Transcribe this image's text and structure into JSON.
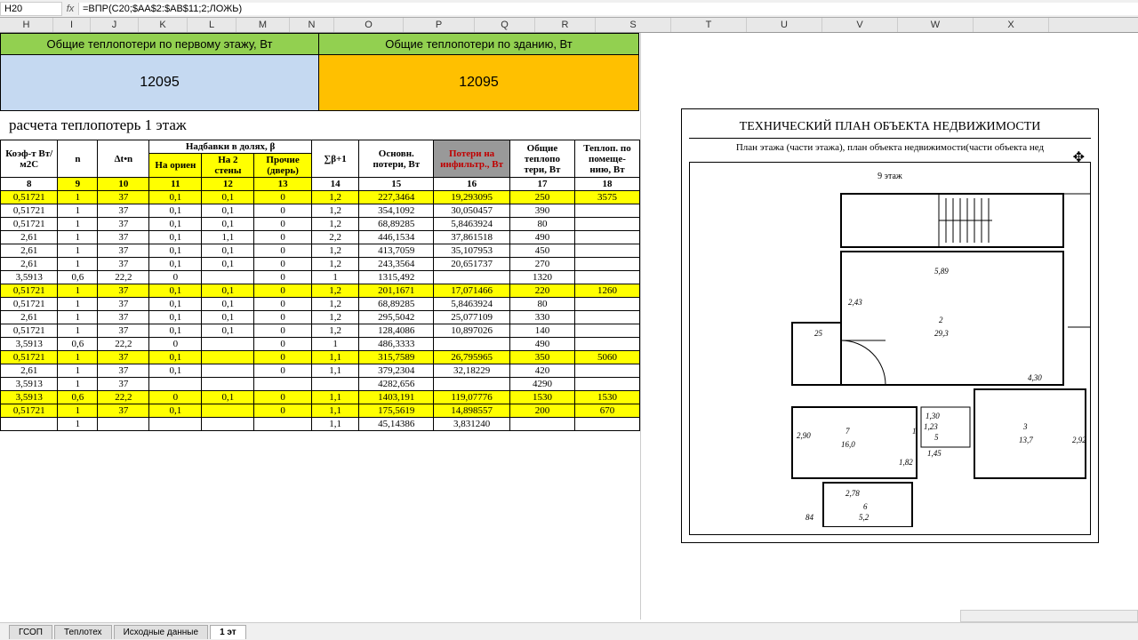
{
  "formula": {
    "cell": "H20",
    "value": "=ВПР(C20;$AA$2:$AB$11;2;ЛОЖЬ)"
  },
  "columns": [
    "H",
    "I",
    "J",
    "K",
    "L",
    "M",
    "N",
    "O",
    "P",
    "Q",
    "R",
    "S",
    "T",
    "U",
    "V",
    "W",
    "X"
  ],
  "summary": {
    "label1": "Общие теплопотери по первому этажу, Вт",
    "label2": "Общие теплопотери по зданию, Вт",
    "val1": "12095",
    "val2": "12095"
  },
  "title": "расчета теплопотерь 1 этаж",
  "headers": {
    "h8": "Коэф-т Вт/м2С",
    "h9": "n",
    "h10": "Δt•n",
    "hAdd": "Надбавки в долях, β",
    "h11": "На ориен",
    "h12": "На 2 стены",
    "h13": "Прочие (дверь)",
    "h14": "∑β+1",
    "h15": "Основн. потери, Вт",
    "h16": "Потери на инфильтр., Вт",
    "h17": "Общие теплопо тери, Вт",
    "h18": "Теплоп. по помеще- нию, Вт",
    "n8": "8",
    "n9": "9",
    "n10": "10",
    "n11": "11",
    "n12": "12",
    "n13": "13",
    "n14": "14",
    "n15": "15",
    "n16": "16",
    "n17": "17",
    "n18": "18"
  },
  "rows": [
    {
      "y": 1,
      "c": [
        "0,51721",
        "1",
        "37",
        "0,1",
        "0,1",
        "0",
        "1,2",
        "227,3464",
        "19,293095",
        "250",
        "3575"
      ]
    },
    {
      "y": 0,
      "c": [
        "0,51721",
        "1",
        "37",
        "0,1",
        "0,1",
        "0",
        "1,2",
        "354,1092",
        "30,050457",
        "390",
        ""
      ]
    },
    {
      "y": 0,
      "c": [
        "0,51721",
        "1",
        "37",
        "0,1",
        "0,1",
        "0",
        "1,2",
        "68,89285",
        "5,8463924",
        "80",
        ""
      ]
    },
    {
      "y": 0,
      "c": [
        "2,61",
        "1",
        "37",
        "0,1",
        "1,1",
        "0",
        "2,2",
        "446,1534",
        "37,861518",
        "490",
        ""
      ]
    },
    {
      "y": 0,
      "c": [
        "2,61",
        "1",
        "37",
        "0,1",
        "0,1",
        "0",
        "1,2",
        "413,7059",
        "35,107953",
        "450",
        ""
      ]
    },
    {
      "y": 0,
      "c": [
        "2,61",
        "1",
        "37",
        "0,1",
        "0,1",
        "0",
        "1,2",
        "243,3564",
        "20,651737",
        "270",
        ""
      ]
    },
    {
      "y": 0,
      "c": [
        "3,5913",
        "0,6",
        "22,2",
        "0",
        "",
        "0",
        "1",
        "1315,492",
        "",
        "1320",
        ""
      ]
    },
    {
      "y": 1,
      "c": [
        "0,51721",
        "1",
        "37",
        "0,1",
        "0,1",
        "0",
        "1,2",
        "201,1671",
        "17,071466",
        "220",
        "1260"
      ]
    },
    {
      "y": 0,
      "c": [
        "0,51721",
        "1",
        "37",
        "0,1",
        "0,1",
        "0",
        "1,2",
        "68,89285",
        "5,8463924",
        "80",
        ""
      ]
    },
    {
      "y": 0,
      "c": [
        "2,61",
        "1",
        "37",
        "0,1",
        "0,1",
        "0",
        "1,2",
        "295,5042",
        "25,077109",
        "330",
        ""
      ]
    },
    {
      "y": 0,
      "c": [
        "0,51721",
        "1",
        "37",
        "0,1",
        "0,1",
        "0",
        "1,2",
        "128,4086",
        "10,897026",
        "140",
        ""
      ]
    },
    {
      "y": 0,
      "c": [
        "3,5913",
        "0,6",
        "22,2",
        "0",
        "",
        "0",
        "1",
        "486,3333",
        "",
        "490",
        ""
      ]
    },
    {
      "y": 1,
      "c": [
        "0,51721",
        "1",
        "37",
        "0,1",
        "",
        "0",
        "1,1",
        "315,7589",
        "26,795965",
        "350",
        "5060"
      ]
    },
    {
      "y": 0,
      "c": [
        "2,61",
        "1",
        "37",
        "0,1",
        "",
        "0",
        "1,1",
        "379,2304",
        "32,18229",
        "420",
        ""
      ]
    },
    {
      "y": 0,
      "c": [
        "3,5913",
        "1",
        "37",
        "",
        "",
        "",
        "",
        "4282,656",
        "",
        "4290",
        ""
      ]
    },
    {
      "y": 1,
      "c": [
        "3,5913",
        "0,6",
        "22,2",
        "0",
        "0,1",
        "0",
        "1,1",
        "1403,191",
        "119,07776",
        "1530",
        "1530"
      ]
    },
    {
      "y": 1,
      "c": [
        "0,51721",
        "1",
        "37",
        "0,1",
        "",
        "0",
        "1,1",
        "175,5619",
        "14,898557",
        "200",
        "670"
      ]
    },
    {
      "y": 0,
      "c": [
        "",
        "1",
        "",
        "",
        "",
        "",
        "1,1",
        "45,14386",
        "3,831240",
        "",
        ""
      ]
    }
  ],
  "plan": {
    "title": "ТЕХНИЧЕСКИЙ ПЛАН ОБЪЕКТА НЕДВИЖИМОСТИ",
    "subtitle": "План этажа (части этажа), план объекта недвижимости(части объекта нед",
    "floor": "9 этаж",
    "dims": {
      "d1": "5,89",
      "d2": "2,43",
      "d3": "29,3",
      "d4": "25",
      "d5": "4,30",
      "d6": "2,90",
      "d7": "7",
      "d8": "16,0",
      "d9": "1,30",
      "d10": "1,23",
      "d11": "5",
      "d12": "1,82",
      "d13": "1,45",
      "d14": "3",
      "d15": "13,7",
      "d16": "2,92",
      "d17": "2,78",
      "d18": "6",
      "d19": "5,2",
      "d20": "84",
      "d21": "2",
      "d22": "1",
      "d23": "2"
    }
  },
  "tabs": [
    "ГСОП",
    "Теплотех",
    "Исходные данные",
    "1 эт"
  ],
  "activeTab": 3
}
